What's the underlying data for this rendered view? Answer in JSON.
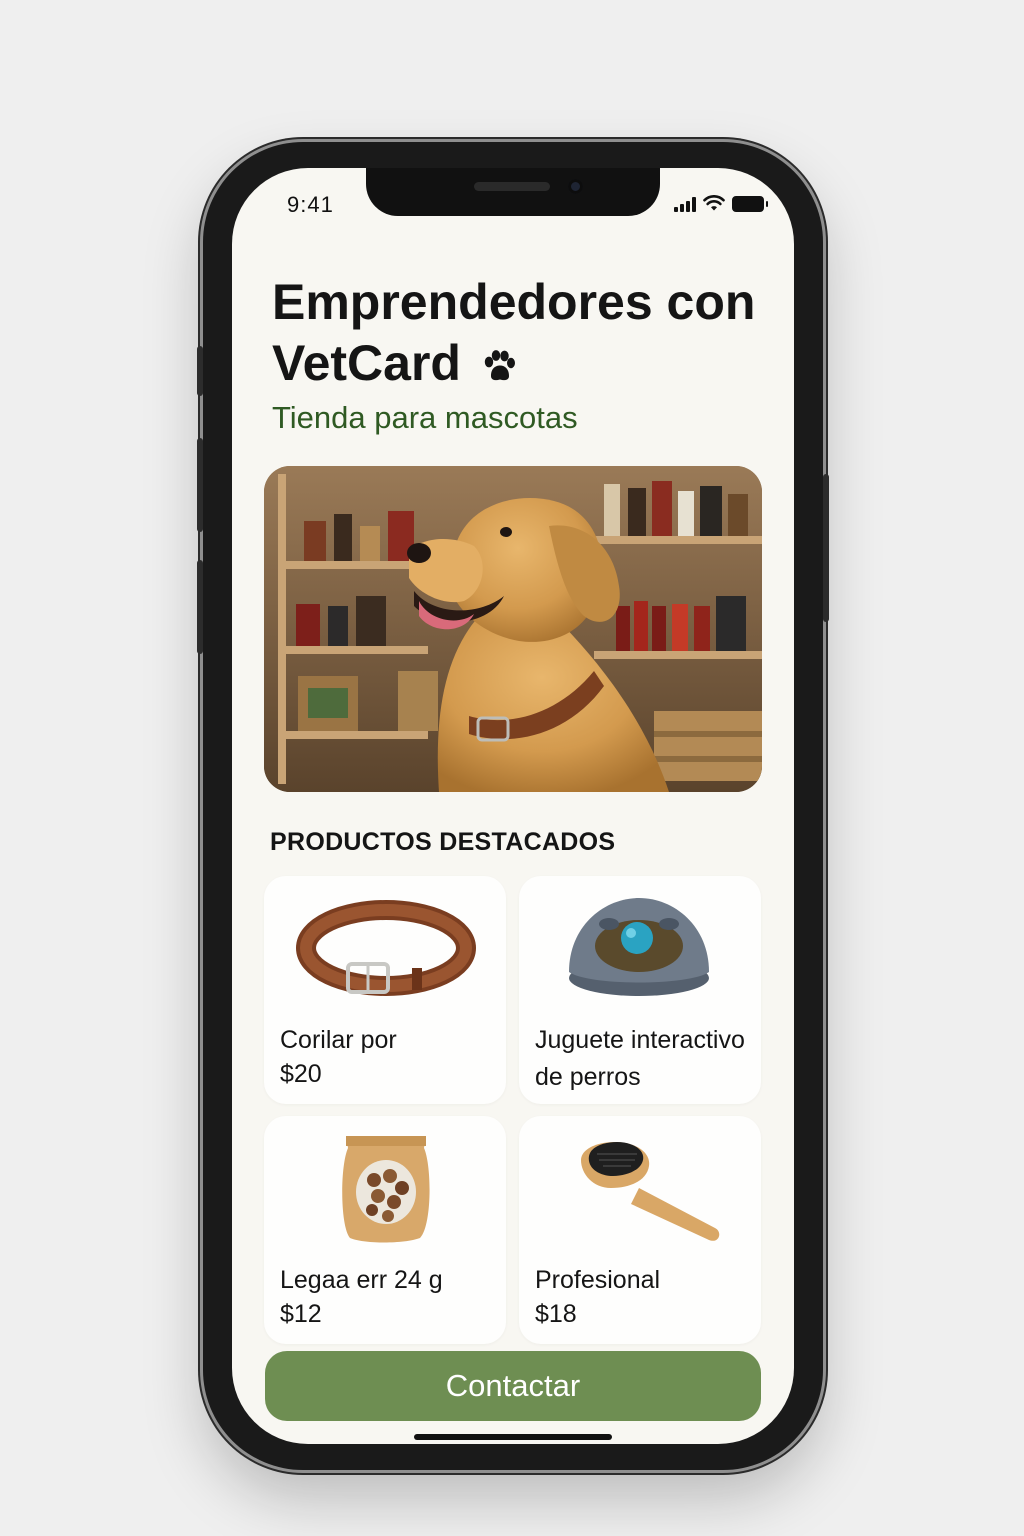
{
  "status_bar": {
    "time": "9:41"
  },
  "header": {
    "title_line1": "Emprendedores con",
    "title_line2": "VetCard",
    "title_icon": "paw-icon",
    "subtitle": "Tienda para mascotas"
  },
  "hero_image": {
    "subject": "dog-photo"
  },
  "featured": {
    "section_title": "PRODUCTOS DESTACADOS",
    "products": [
      {
        "name": "Corilar por",
        "price": "$20",
        "icon": "collar-icon"
      },
      {
        "name": "Juguete interactivo de perros",
        "price": "",
        "icon": "dog-toy-icon"
      },
      {
        "name": "Legaa err 24 g",
        "price": "$12",
        "icon": "treat-bag-icon"
      },
      {
        "name": "Profesional",
        "price": "$18",
        "icon": "grooming-brush-icon"
      }
    ]
  },
  "cta": {
    "label": "Contactar"
  },
  "colors": {
    "accent": "#6e8e52",
    "subtitle": "#2f5a23",
    "background": "#f8f7f2"
  }
}
